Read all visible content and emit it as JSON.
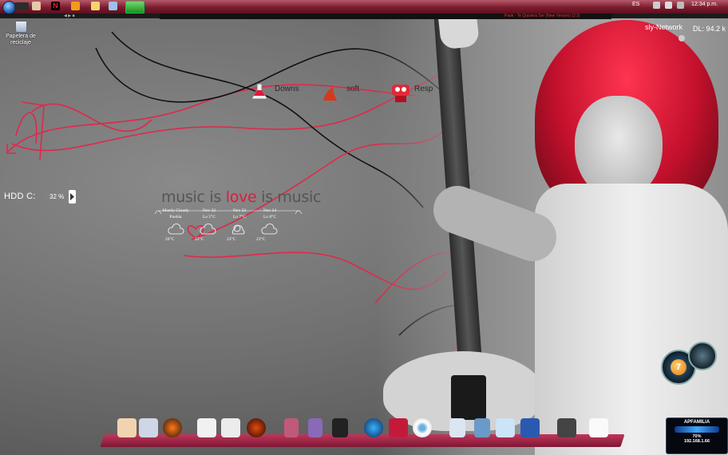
{
  "taskbar": {
    "language": "ES",
    "clock": "12:34 p.m."
  },
  "media": {
    "now_playing": "Paok - Te Quisiera Ser (New Version) (2:2)"
  },
  "desktop": {
    "recycle_bin": {
      "label": "Papelera de reciclaje",
      "icon": "recycle-bin-icon"
    }
  },
  "rocketdock": {
    "items": [
      {
        "label": "Downs",
        "icon": "flask-icon"
      },
      {
        "label": "soft",
        "icon": "dragon-icon"
      },
      {
        "label": "Resp",
        "icon": "robot-icon"
      }
    ]
  },
  "hdd": {
    "label": "HDD C:",
    "value": "32 %"
  },
  "wallpaper_text": {
    "part1": "music is ",
    "part2": "love",
    "part3": " is music"
  },
  "weather": {
    "days": [
      {
        "day": "Mostly Cloudy",
        "cond": "Puebla",
        "temp": "20°C"
      },
      {
        "day": "Nov 22",
        "cond": "Lo 5°C",
        "temp": "22°C"
      },
      {
        "day": "Nov 23",
        "cond": "Lo 7°C",
        "temp": "23°C"
      },
      {
        "day": "Nov 24",
        "cond": "Lo 8°C",
        "temp": "23°C"
      }
    ]
  },
  "network": {
    "name": "sly-Network",
    "download": "DL: 94.2 k"
  },
  "wifi": {
    "ssid": "APFAMILIA",
    "percent": "70%",
    "ip": "192.168.1.66"
  },
  "gauges": {
    "cpu_value": "7"
  },
  "colors": {
    "accent": "#e11a3c",
    "taskbar": "#7a1b2d"
  }
}
